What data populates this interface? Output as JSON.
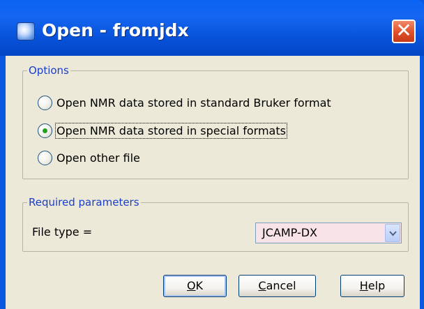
{
  "window": {
    "title": "Open - fromjdx",
    "close_glyph": "✕",
    "app_icon": "topspin-app-icon"
  },
  "options": {
    "legend": "Options",
    "items": [
      {
        "label": "Open NMR data stored in standard Bruker format",
        "checked": false
      },
      {
        "label": "Open NMR data stored in special formats",
        "checked": true
      },
      {
        "label": "Open other file",
        "checked": false
      }
    ]
  },
  "params": {
    "legend": "Required parameters",
    "file_type_label": "File type =",
    "file_type_value": "JCAMP-DX"
  },
  "buttons": {
    "ok": {
      "mnemonic": "O",
      "rest": "K"
    },
    "cancel": {
      "mnemonic": "C",
      "rest": "ancel"
    },
    "help": {
      "mnemonic": "H",
      "rest": "elp"
    }
  },
  "colors": {
    "titlebar": "#0b5fe8",
    "legend_text": "#1a3ec8",
    "dialog_bg": "#ece9d8",
    "close_button": "#e04f2a",
    "select_bg": "#f8e4e8",
    "radio_dot": "#21a121"
  }
}
